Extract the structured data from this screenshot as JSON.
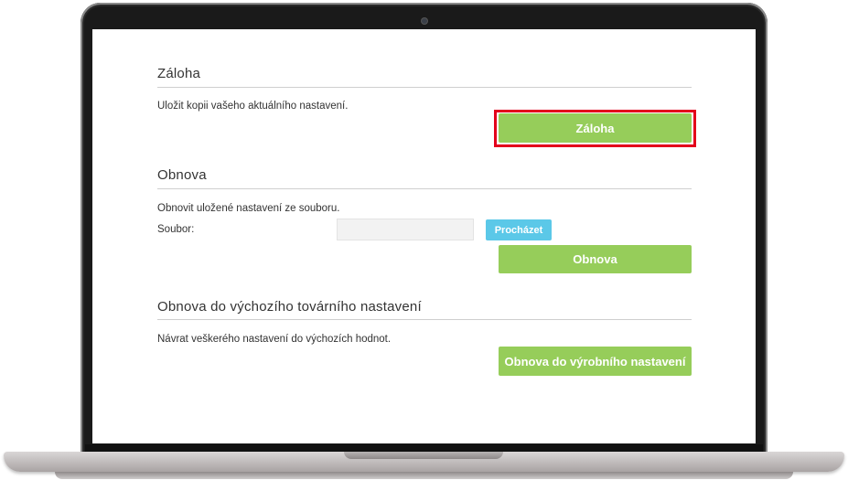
{
  "backup": {
    "title": "Záloha",
    "description": "Uložit kopii vašeho aktuálního nastavení.",
    "button_label": "Záloha"
  },
  "restore": {
    "title": "Obnova",
    "description": "Obnovit uložené nastavení ze souboru.",
    "file_label": "Soubor:",
    "file_value": "",
    "browse_label": "Procházet",
    "button_label": "Obnova"
  },
  "factory": {
    "title": "Obnova do výchozího továrního nastavení",
    "description": "Návrat veškerého nastavení do výchozích hodnot.",
    "button_label": "Obnova do výrobního nastavení"
  },
  "colors": {
    "button_green": "#96cd5a",
    "browse_blue": "#5bc8e8",
    "highlight_red": "#e3001b"
  }
}
